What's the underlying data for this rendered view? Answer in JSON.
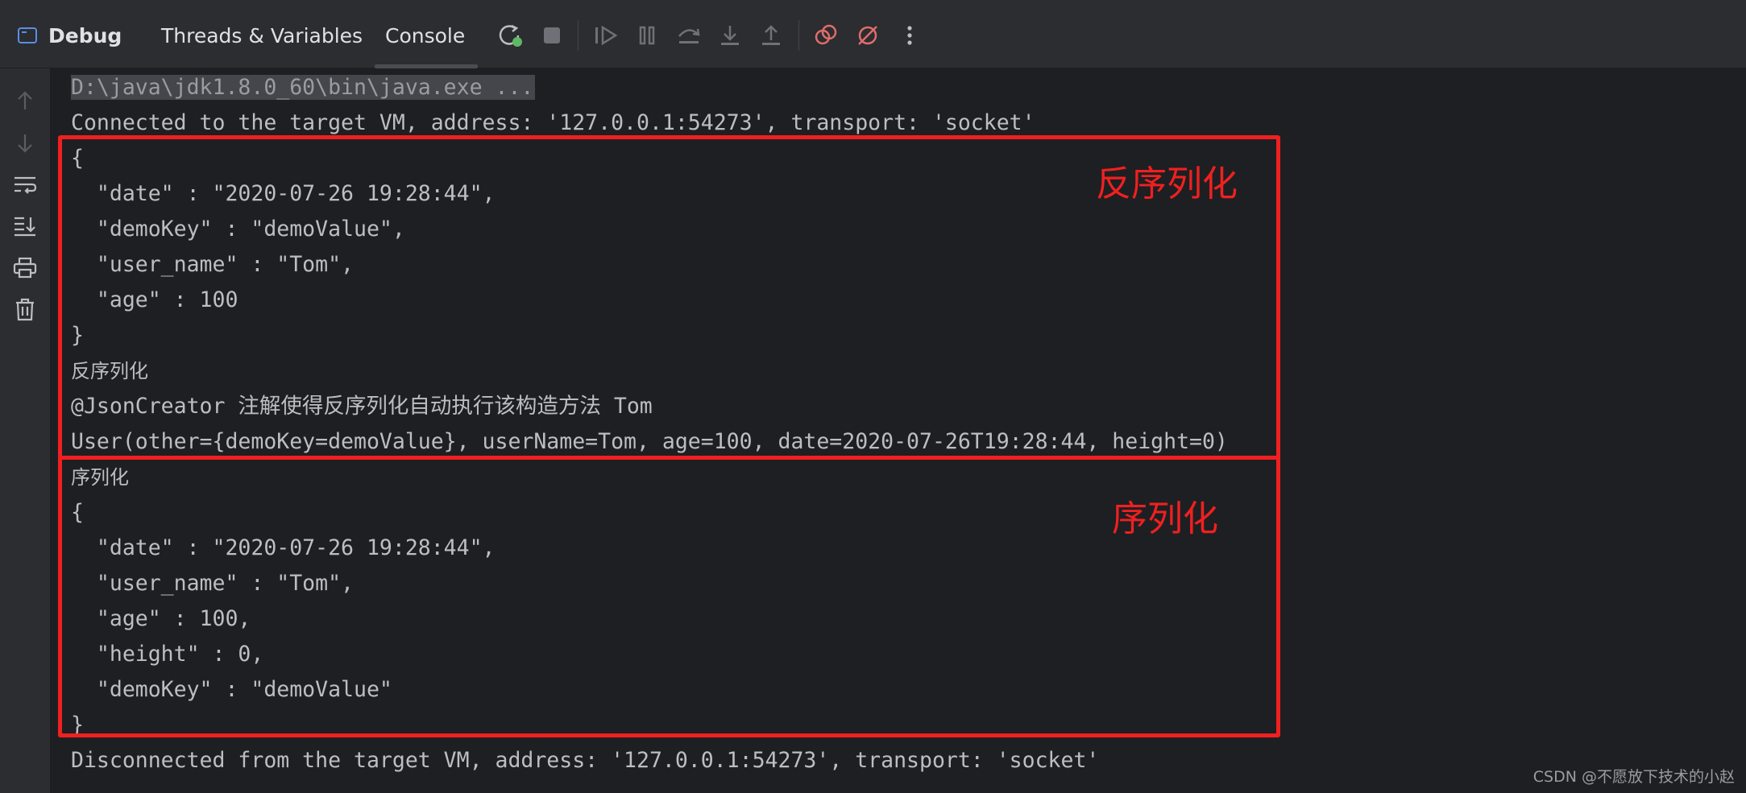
{
  "toolbar": {
    "debug_label": "Debug",
    "tabs": [
      {
        "label": "Threads & Variables"
      },
      {
        "label": "Console"
      }
    ],
    "icons": [
      "rerun-icon",
      "stop-icon",
      "resume-icon",
      "pause-icon",
      "step-over-icon",
      "step-into-icon",
      "step-out-icon",
      "view-breakpoints-icon",
      "mute-breakpoints-icon",
      "more-options-icon"
    ]
  },
  "sidebar": {
    "icons": [
      "scroll-up-icon",
      "scroll-down-icon",
      "soft-wrap-icon",
      "scroll-to-end-icon",
      "print-icon",
      "clear-all-icon"
    ]
  },
  "console": {
    "lines": [
      "D:\\java\\jdk1.8.0_60\\bin\\java.exe ...",
      "Connected to the target VM, address: '127.0.0.1:54273', transport: 'socket'",
      "{",
      "  \"date\" : \"2020-07-26 19:28:44\",",
      "  \"demoKey\" : \"demoValue\",",
      "  \"user_name\" : \"Tom\",",
      "  \"age\" : 100",
      "}",
      "反序列化",
      "@JsonCreator 注解使得反序列化自动执行该构造方法 Tom",
      "User(other={demoKey=demoValue}, userName=Tom, age=100, date=2020-07-26T19:28:44, height=0)",
      "序列化",
      "{",
      "  \"date\" : \"2020-07-26 19:28:44\",",
      "  \"user_name\" : \"Tom\",",
      "  \"age\" : 100,",
      "  \"height\" : 0,",
      "  \"demoKey\" : \"demoValue\"",
      "}",
      "Disconnected from the target VM, address: '127.0.0.1:54273', transport: 'socket'"
    ]
  },
  "annotations": {
    "deserialize_label": "反序列化",
    "serialize_label": "序列化",
    "color": "#f02020"
  },
  "watermark": "CSDN @不愿放下技术的小赵",
  "colors": {
    "background": "#1e1f22",
    "toolbar": "#2b2d30",
    "text": "#bcbec4",
    "accent_blue": "#5a8ee6",
    "debug_red": "#e06c6c",
    "rerun_green": "#5fb865"
  }
}
